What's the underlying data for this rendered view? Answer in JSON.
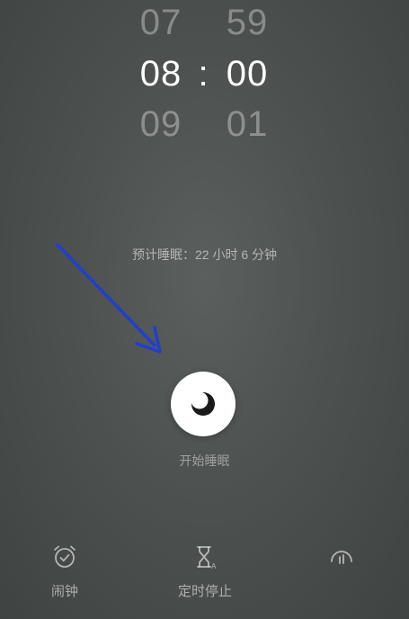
{
  "time_picker": {
    "hours": [
      "07",
      "08",
      "09"
    ],
    "minutes": [
      "59",
      "00",
      "01"
    ],
    "separator": ":"
  },
  "sleep_estimate": "预计睡眠：22 小时 6 分钟",
  "start_sleep": {
    "label": "开始睡眠",
    "icon": "moon-icon"
  },
  "bottom_nav": {
    "items": [
      {
        "label": "闹钟",
        "icon": "alarm-clock-icon"
      },
      {
        "label": "定时停止",
        "icon": "hourglass-icon"
      },
      {
        "label": "",
        "icon": "sound-icon"
      }
    ]
  },
  "colors": {
    "background": "#4d514f",
    "annotation_arrow": "#1f3fd0",
    "button": "#ffffff"
  }
}
